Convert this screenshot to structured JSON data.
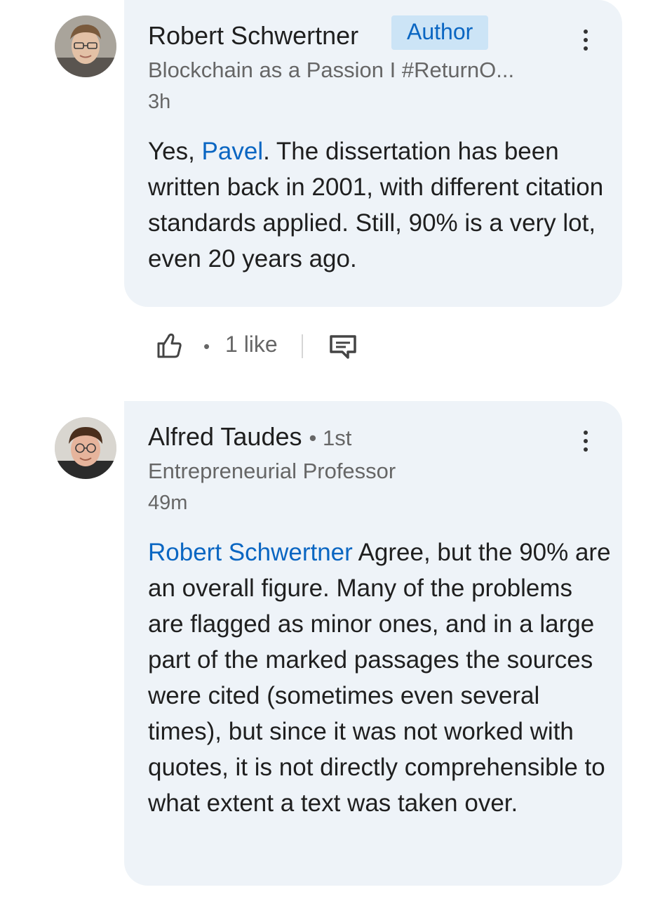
{
  "comments": [
    {
      "author": "Robert Schwertner",
      "badge": "Author",
      "headline": "Blockchain as a Passion I #ReturnO...",
      "time": "3h",
      "mention": "Pavel",
      "text_before": "Yes, ",
      "text_after": ". The dissertation has been written back in 2001, with different citation standards applied. Still, 90% is a very lot, even 20 years ago.",
      "avatar_icon": "avatar-photo"
    },
    {
      "author": "Alfred Taudes",
      "degree": "• 1st",
      "headline": "Entrepreneurial Professor",
      "time": "49m",
      "mention": "Robert Schwertner",
      "text_after": " Agree, but the 90% are an overall figure. Many of the problems are flagged as minor ones, and in a large part of the marked passages the sources were cited (sometimes even several times), but since it was not worked with quotes, it is not directly comprehensible to what extent a text was taken over.",
      "avatar_icon": "avatar-photo"
    }
  ],
  "actions": {
    "like_icon": "thumbs-up-icon",
    "separator": "•",
    "like_count": "1 like",
    "reply_icon": "reply-icon"
  },
  "colors": {
    "bubble": "#eef3f8",
    "link": "#0a66c2",
    "badge_bg": "#cce4f6"
  }
}
